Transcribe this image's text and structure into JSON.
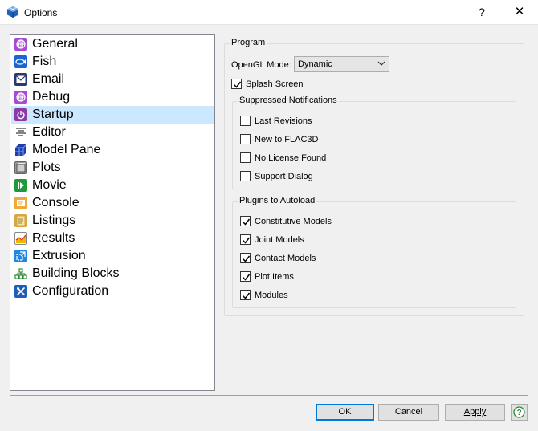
{
  "window": {
    "title": "Options",
    "help_label": "?",
    "close_label": "✕"
  },
  "nav": {
    "items": [
      {
        "label": "General",
        "icon": "general-icon",
        "selected": false
      },
      {
        "label": "Fish",
        "icon": "fish-icon",
        "selected": false
      },
      {
        "label": "Email",
        "icon": "email-icon",
        "selected": false
      },
      {
        "label": "Debug",
        "icon": "debug-icon",
        "selected": false
      },
      {
        "label": "Startup",
        "icon": "startup-icon",
        "selected": true
      },
      {
        "label": "Editor",
        "icon": "editor-icon",
        "selected": false
      },
      {
        "label": "Model Pane",
        "icon": "model-pane-icon",
        "selected": false
      },
      {
        "label": "Plots",
        "icon": "plots-icon",
        "selected": false
      },
      {
        "label": "Movie",
        "icon": "movie-icon",
        "selected": false
      },
      {
        "label": "Console",
        "icon": "console-icon",
        "selected": false
      },
      {
        "label": "Listings",
        "icon": "listings-icon",
        "selected": false
      },
      {
        "label": "Results",
        "icon": "results-icon",
        "selected": false
      },
      {
        "label": "Extrusion",
        "icon": "extrusion-icon",
        "selected": false
      },
      {
        "label": "Building Blocks",
        "icon": "building-blocks-icon",
        "selected": false
      },
      {
        "label": "Configuration",
        "icon": "configuration-icon",
        "selected": false
      }
    ]
  },
  "program": {
    "title": "Program",
    "opengl_label": "OpenGL Mode:",
    "opengl_value": "Dynamic",
    "splash_label": "Splash Screen",
    "splash_checked": true
  },
  "suppressed": {
    "title": "Suppressed Notifications",
    "items": [
      {
        "label": "Last Revisions",
        "checked": false
      },
      {
        "label": "New to FLAC3D",
        "checked": false
      },
      {
        "label": "No License Found",
        "checked": false
      },
      {
        "label": "Support Dialog",
        "checked": false
      }
    ]
  },
  "plugins": {
    "title": "Plugins to Autoload",
    "items": [
      {
        "label": "Constitutive Models",
        "checked": true
      },
      {
        "label": "Joint Models",
        "checked": true
      },
      {
        "label": "Contact Models",
        "checked": true
      },
      {
        "label": "Plot Items",
        "checked": true
      },
      {
        "label": "Modules",
        "checked": true
      }
    ]
  },
  "buttons": {
    "ok": "OK",
    "cancel": "Cancel",
    "apply": "Apply",
    "help": "?"
  },
  "colors": {
    "selection": "#cce8ff",
    "accent": "#0078d7"
  }
}
